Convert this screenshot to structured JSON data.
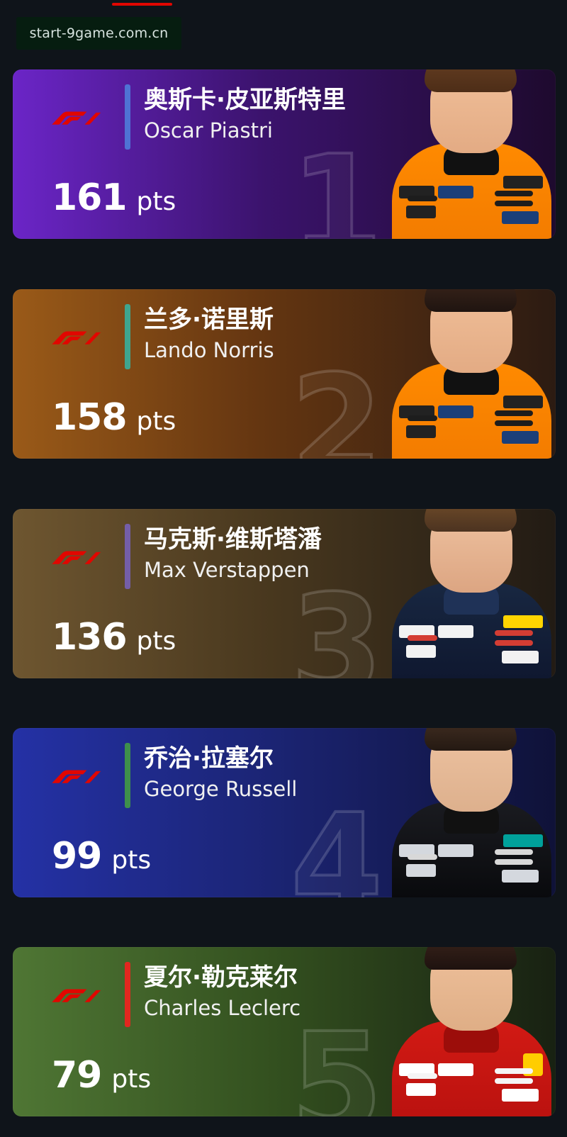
{
  "watermark": {
    "text": "start-9game.com.cn"
  },
  "drivers": [
    {
      "chinese_name": "奥斯卡·皮亚斯特里",
      "english_name": "Oscar Piastri",
      "points": "161",
      "points_unit": "pts",
      "rank": "1",
      "card_color": "#6b25c7",
      "accent_color": "#4f72d4",
      "portrait_icon": "driver-portrait-icon"
    },
    {
      "chinese_name": "兰多·诺里斯",
      "english_name": "Lando Norris",
      "points": "158",
      "points_unit": "pts",
      "rank": "2",
      "card_color": "#9a5a18",
      "accent_color": "#3fa58e",
      "portrait_icon": "driver-portrait-icon"
    },
    {
      "chinese_name": "马克斯·维斯塔潘",
      "english_name": "Max Verstappen",
      "points": "136",
      "points_unit": "pts",
      "rank": "3",
      "card_color": "#6e5630",
      "accent_color": "#745ea8",
      "portrait_icon": "driver-portrait-icon"
    },
    {
      "chinese_name": "乔治·拉塞尔",
      "english_name": "George Russell",
      "points": "99",
      "points_unit": "pts",
      "rank": "4",
      "card_color": "#2431a5",
      "accent_color": "#3e8f4c",
      "portrait_icon": "driver-portrait-icon"
    },
    {
      "chinese_name": "夏尔·勒克莱尔",
      "english_name": "Charles Leclerc",
      "points": "79",
      "points_unit": "pts",
      "rank": "5",
      "card_color": "#4f7634",
      "accent_color": "#e2271f",
      "portrait_icon": "driver-portrait-icon"
    }
  ],
  "icons": {
    "brand_logo": "f1-logo-icon"
  },
  "colors": {
    "page_background": "#0f141a",
    "top_indicator": "#e10600",
    "watermark_background": "#051e10"
  }
}
